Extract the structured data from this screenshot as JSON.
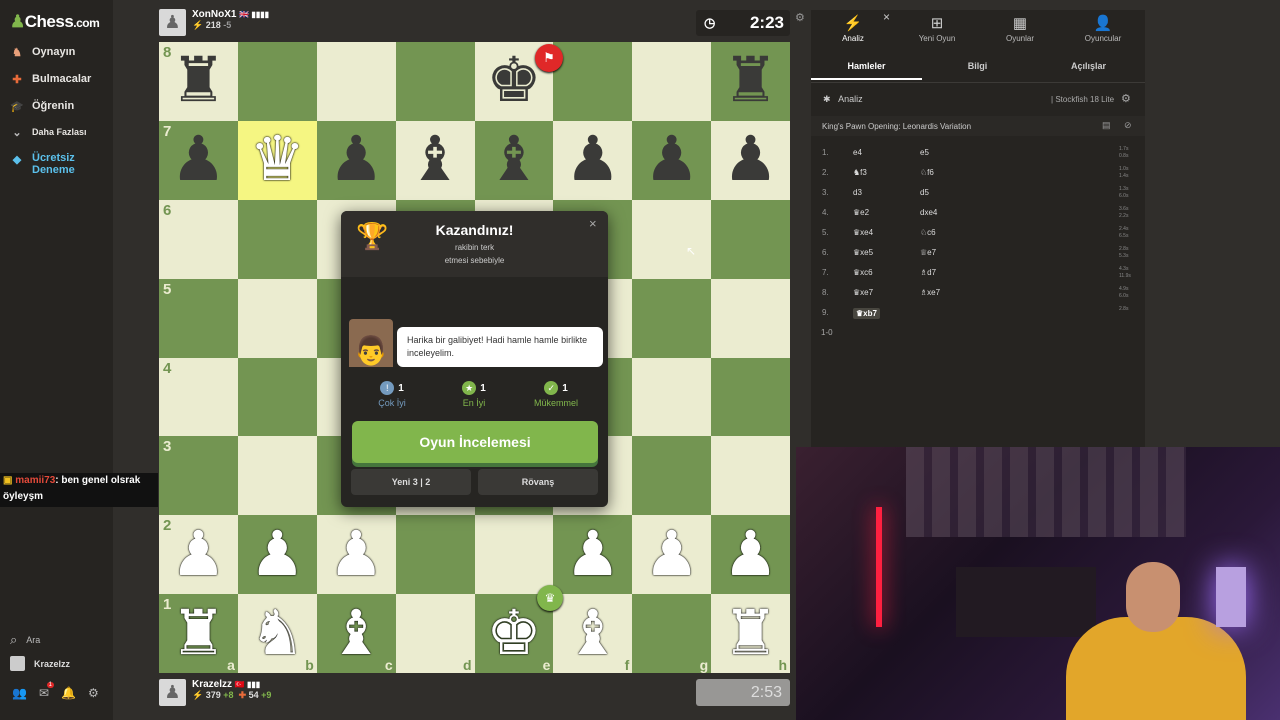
{
  "sidebar": {
    "logo_text": "Chess",
    "logo_suffix": ".com",
    "items": [
      {
        "label": "Oynayın",
        "icon": "play-icon",
        "color": "#e9a07a"
      },
      {
        "label": "Bulmacalar",
        "icon": "puzzle-icon",
        "color": "#e86b3a"
      },
      {
        "label": "Öğrenin",
        "icon": "learn-icon",
        "color": "#4aa8d8"
      },
      {
        "label": "Daha Fazlası",
        "icon": "chevron-down-icon",
        "color": "#bbbbbb"
      },
      {
        "label": "Ücretsiz Deneme",
        "icon": "diamond-icon",
        "color": "#5bc0eb"
      }
    ],
    "search_label": "Ara",
    "user_label": "Krazelzz",
    "notif_count": "1"
  },
  "chat": {
    "user": "mamii73",
    "message": ": ben genel olsrak öyleyşm"
  },
  "top_player": {
    "name": "XonNoX1",
    "rating": "218",
    "rating_change": "-5",
    "clock": "2:23"
  },
  "bottom_player": {
    "name": "Krazelzz",
    "stat1": "379",
    "stat1_change": "+8",
    "stat2": "54",
    "stat2_change": "+9",
    "clock": "2:53"
  },
  "board": {
    "ranks": [
      "8",
      "7",
      "6",
      "5",
      "4",
      "3",
      "2",
      "1"
    ],
    "files": [
      "a",
      "b",
      "c",
      "d",
      "e",
      "f",
      "g",
      "h"
    ],
    "position": [
      [
        "bR",
        "",
        "",
        "",
        "bK",
        "",
        "",
        "bR"
      ],
      [
        "bP",
        "wQ",
        "bP",
        "bB",
        "bB",
        "bP",
        "bP",
        "bP"
      ],
      [
        "",
        "",
        "",
        "",
        "",
        "",
        "",
        ""
      ],
      [
        "",
        "",
        "",
        "",
        "",
        "",
        "",
        ""
      ],
      [
        "",
        "",
        "",
        "",
        "",
        "",
        "",
        ""
      ],
      [
        "",
        "",
        "",
        "",
        "",
        "",
        "",
        ""
      ],
      [
        "wP",
        "wP",
        "wP",
        "",
        "",
        "wP",
        "wP",
        "wP"
      ],
      [
        "wR",
        "wN",
        "wB",
        "",
        "wK",
        "wB",
        "",
        "wR"
      ]
    ],
    "highlight": "b7",
    "light_color": "#ebecd0",
    "dark_color": "#739552"
  },
  "modal": {
    "title": "Kazandınız!",
    "subtitle_line1": "rakibin terk",
    "subtitle_line2": "etmesi sebebiyle",
    "coach_message": "Harika bir galibiyet! Hadi hamle hamle birlikte inceleyelim.",
    "stats": [
      {
        "count": "1",
        "label": "Çok İyi",
        "color": "#749bbf",
        "symbol": "!"
      },
      {
        "count": "1",
        "label": "En İyi",
        "color": "#81b64c",
        "symbol": "★"
      },
      {
        "count": "1",
        "label": "Mükemmel",
        "color": "#81b64c",
        "symbol": "👍"
      }
    ],
    "review_button": "Oyun İncelemesi",
    "new_game_button": "Yeni 3 | 2",
    "rematch_button": "Rövanş"
  },
  "panel": {
    "tabs": [
      {
        "label": "Analiz",
        "icon": "analysis-icon"
      },
      {
        "label": "Yeni Oyun",
        "icon": "new-game-icon"
      },
      {
        "label": "Oyunlar",
        "icon": "games-icon"
      },
      {
        "label": "Oyuncular",
        "icon": "players-icon"
      }
    ],
    "subtabs": [
      "Hamleler",
      "Bilgi",
      "Açılışlar"
    ],
    "analysis_label": "Analiz",
    "engine_label": "Stockfish 18 Lite",
    "opening_name": "King's Pawn Opening: Leonardis Variation",
    "moves": [
      {
        "n": "1.",
        "w": "e4",
        "b": "e5",
        "wt": "1.7s",
        "bt": "0.8s"
      },
      {
        "n": "2.",
        "w": "♞f3",
        "b": "♘f6",
        "wt": "1.0s",
        "bt": "1.4s"
      },
      {
        "n": "3.",
        "w": "d3",
        "b": "d5",
        "wt": "1.3s",
        "bt": "6.0s"
      },
      {
        "n": "4.",
        "w": "♛e2",
        "b": "dxe4",
        "wt": "3.6s",
        "bt": "2.2s"
      },
      {
        "n": "5.",
        "w": "♛xe4",
        "b": "♘c6",
        "wt": "2.4s",
        "bt": "6.5s"
      },
      {
        "n": "6.",
        "w": "♛xe5",
        "b": "♕e7",
        "wt": "2.8s",
        "bt": "5.3s"
      },
      {
        "n": "7.",
        "w": "♛xc6",
        "b": "♗d7",
        "wt": "4.3s",
        "bt": "11.9s"
      },
      {
        "n": "8.",
        "w": "♛xe7",
        "b": "♗xe7",
        "wt": "4.9s",
        "bt": "6.0s"
      },
      {
        "n": "9.",
        "w": "♛xb7",
        "b": "",
        "wt": "2.8s",
        "bt": ""
      }
    ],
    "result": "1-0"
  }
}
